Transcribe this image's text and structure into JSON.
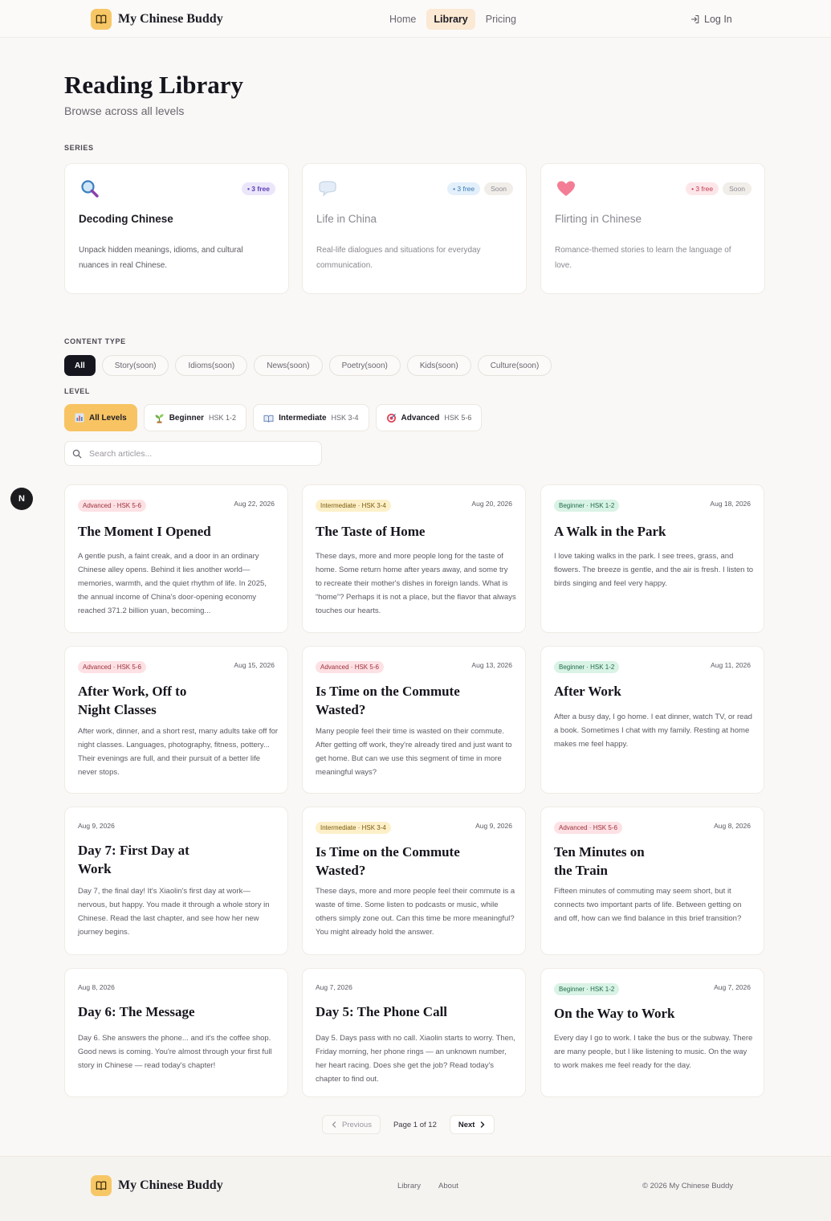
{
  "app": {
    "name": "My Chinese Buddy",
    "logo_icon": "book-icon"
  },
  "nav": {
    "items": [
      "Home",
      "Library",
      "Pricing"
    ],
    "active": "Library",
    "login": "Log In"
  },
  "hero": {
    "title": "Reading Library",
    "subtitle": "Browse across all levels"
  },
  "labels": {
    "series": "SERIES",
    "content_type": "CONTENT TYPE",
    "level": "LEVEL"
  },
  "series": [
    {
      "title": "Decoding Chinese",
      "desc": "Unpack hidden meanings, idioms, and cultural nuances in real Chinese.",
      "free": "• 3 free",
      "soon": "",
      "icon": "magnifier-icon"
    },
    {
      "title": "Life in China",
      "desc": "Real-life dialogues and situations for everyday communication.",
      "free": "• 3 free",
      "soon": "Soon",
      "icon": "speech-bubble-icon"
    },
    {
      "title": "Flirting in Chinese",
      "desc": "Romance-themed stories to learn the language of love.",
      "free": "• 3 free",
      "soon": "Soon",
      "icon": "heart-icon"
    }
  ],
  "content_types": [
    "All",
    "Story(soon)",
    "Idioms(soon)",
    "News(soon)",
    "Poetry(soon)",
    "Kids(soon)",
    "Culture(soon)"
  ],
  "levels": [
    {
      "name": "All Levels",
      "sub": "",
      "icon": "chart-icon"
    },
    {
      "name": "Beginner",
      "sub": "HSK 1-2",
      "icon": "sprout-icon"
    },
    {
      "name": "Intermediate",
      "sub": "HSK 3-4",
      "icon": "book-open-icon"
    },
    {
      "name": "Advanced",
      "sub": "HSK 5-6",
      "icon": "target-icon"
    }
  ],
  "search": {
    "placeholder": "Search articles..."
  },
  "floating": {
    "label": "N"
  },
  "articles": [
    {
      "level": "Advanced · HSK 5-6",
      "date": "Aug 22, 2026",
      "title": "The Moment I Opened",
      "excerpt": "A gentle push, a faint creak, and a door in an ordinary Chinese alley opens. Behind it lies another world—memories, warmth, and the quiet rhythm of life. In 2025, the annual income of China's door-opening economy reached 371.2 billion yuan, becoming..."
    },
    {
      "level": "Intermediate · HSK 3-4",
      "date": "Aug 20, 2026",
      "title": "The Taste of Home",
      "excerpt": "These days, more and more people long for the taste of home. Some return home after years away, and some try to recreate their mother's dishes in foreign lands. What is “home”? Perhaps it is not a place, but the flavor that always touches our hearts."
    },
    {
      "level": "Beginner · HSK 1-2",
      "date": "Aug 18, 2026",
      "title": "A Walk in the Park",
      "excerpt": "I love taking walks in the park. I see trees, grass, and flowers. The breeze is gentle, and the air is fresh. I listen to birds singing and feel very happy."
    },
    {
      "level": "Advanced · HSK 5-6",
      "date": "Aug 15, 2026",
      "title": "After Work, Off to Night Classes",
      "excerpt": "After work, dinner, and a short rest, many adults take off for night classes. Languages, photography, fitness, pottery... Their evenings are full, and their pursuit of a better life never stops."
    },
    {
      "level": "Advanced · HSK 5-6",
      "date": "Aug 13, 2026",
      "title": "Is Time on the Commute Wasted?",
      "excerpt": "Many people feel their time is wasted on their commute. After getting off work, they're already tired and just want to get home. But can we use this segment of time in more meaningful ways?"
    },
    {
      "level": "Beginner · HSK 1-2",
      "date": "Aug 11, 2026",
      "title": "After Work",
      "excerpt": "After a busy day, I go home. I eat dinner, watch TV, or read a book. Sometimes I chat with my family. Resting at home makes me feel happy."
    },
    {
      "level": "",
      "date": "Aug 9, 2026",
      "title": "Day 7: First Day at Work",
      "excerpt": "Day 7, the final day! It's Xiaolin's first day at work—nervous, but happy. You made it through a whole story in Chinese. Read the last chapter, and see how her new journey begins."
    },
    {
      "level": "Intermediate · HSK 3-4",
      "date": "Aug 9, 2026",
      "title": "Is Time on the Commute Wasted?",
      "excerpt": "These days, more and more people feel their commute is a waste of time. Some listen to podcasts or music, while others simply zone out. Can this time be more meaningful? You might already hold the answer."
    },
    {
      "level": "Advanced · HSK 5-6",
      "date": "Aug 8, 2026",
      "title": "Ten Minutes on the Train",
      "excerpt": "Fifteen minutes of commuting may seem short, but it connects two important parts of life. Between getting on and off, how can we find balance in this brief transition?"
    },
    {
      "level": "",
      "date": "Aug 8, 2026",
      "title": "Day 6: The Message",
      "excerpt": "Day 6. She answers the phone... and it's the coffee shop. Good news is coming. You're almost through your first full story in Chinese — read today's chapter!"
    },
    {
      "level": "",
      "date": "Aug 7, 2026",
      "title": "Day 5: The Phone Call",
      "excerpt": "Day 5. Days pass with no call. Xiaolin starts to worry. Then, Friday morning, her phone rings — an unknown number, her heart racing. Does she get the job? Read today's chapter to find out."
    },
    {
      "level": "Beginner · HSK 1-2",
      "date": "Aug 7, 2026",
      "title": "On the Way to Work",
      "excerpt": "Every day I go to work. I take the bus or the subway. There are many people, but I like listening to music. On the way to work makes me feel ready for the day."
    }
  ],
  "pagination": {
    "previous": "Previous",
    "info": "Page 1 of 12",
    "next": "Next"
  },
  "footer": {
    "links": [
      "Library",
      "About"
    ],
    "copyright": "© 2026 My Chinese Buddy"
  }
}
